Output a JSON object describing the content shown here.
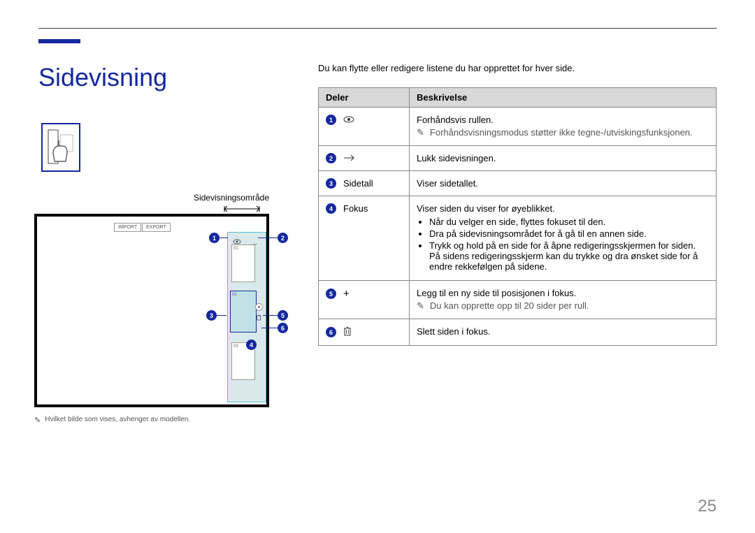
{
  "page": {
    "title": "Sidevisning",
    "area_label": "Sidevisningsområde",
    "image_note": "Hvilket bilde som vises, avhenger av modellen.",
    "page_number": "25"
  },
  "intro": "Du kan flytte eller redigere listene du har opprettet for hver side.",
  "table": {
    "header_parts": "Deler",
    "header_desc": "Beskrivelse",
    "rows": [
      {
        "num": "1",
        "icon": "eye",
        "label": "",
        "desc_main": "Forhåndsvis rullen.",
        "note": "Forhåndsvisningsmodus støtter ikke tegne-/utviskingsfunksjonen."
      },
      {
        "num": "2",
        "icon": "arrow-right",
        "label": "",
        "desc_main": "Lukk sidevisningen."
      },
      {
        "num": "3",
        "icon": "",
        "label": "Sidetall",
        "desc_main": "Viser sidetallet."
      },
      {
        "num": "4",
        "icon": "",
        "label": "Fokus",
        "desc_main": "Viser siden du viser for øyeblikket.",
        "bullets": [
          "Når du velger en side, flyttes fokuset til den.",
          "Dra på sidevisningsområdet for å gå til en annen side.",
          "Trykk og hold på en side for å åpne redigeringsskjermen for siden. På sidens redigeringsskjerm kan du trykke og dra ønsket side for å endre rekkefølgen på sidene."
        ]
      },
      {
        "num": "5",
        "icon": "plus",
        "label": "",
        "desc_main": "Legg til en ny side til posisjonen i fokus.",
        "note": "Du kan opprette opp til 20 sider per rull."
      },
      {
        "num": "6",
        "icon": "trash",
        "label": "",
        "desc_main": "Slett siden i fokus."
      }
    ]
  },
  "screenshot": {
    "import": "IMPORT",
    "export": "EXPORT",
    "pg1": "01",
    "pg2": "02",
    "pg3": "03",
    "callouts": {
      "c1": "1",
      "c2": "2",
      "c3": "3",
      "c4": "4",
      "c5": "5",
      "c6": "6"
    }
  }
}
